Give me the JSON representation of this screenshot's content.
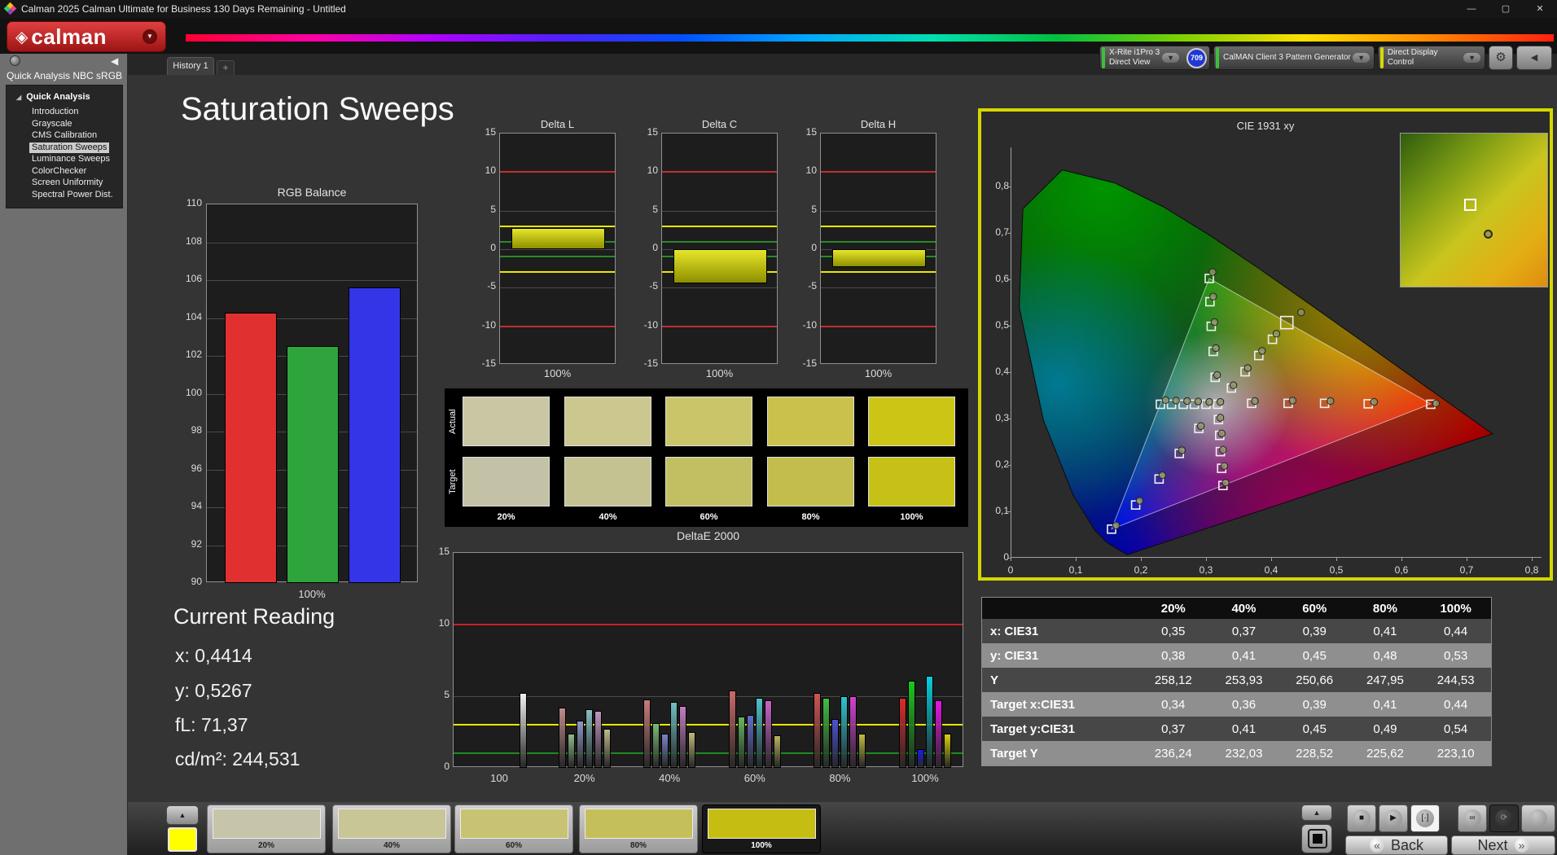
{
  "window": {
    "title": "Calman 2025 Calman Ultimate for Business 130 Days Remaining  - Untitled"
  },
  "icons": {
    "logo_diamond": "◈",
    "caret_down": "▼",
    "collapse_left": "◀",
    "tree_expander": "◢",
    "minimize": "—",
    "maximize": "▢",
    "close": "✕",
    "gear": "⚙",
    "plus": "+",
    "up_arrow": "▲",
    "stop": "■",
    "play": "▶",
    "pattern_window": "[·]",
    "infinity": "∞",
    "sync": "⟳",
    "back_chevron": "«",
    "next_chevron": "»"
  },
  "logo": {
    "text": "calman"
  },
  "tabs": [
    {
      "label": "History 1",
      "active": true
    },
    {
      "label": "+",
      "active": false
    }
  ],
  "meters": [
    {
      "line1": "X-Rite i1Pro 3",
      "line2": "Direct View",
      "accent": "#3dbf3d",
      "badge": "709"
    },
    {
      "line1": "CalMAN Client 3 Pattern Generator",
      "line2": "",
      "accent": "#3dbf3d",
      "badge": ""
    },
    {
      "line1": "Direct Display Control",
      "line2": "",
      "accent": "#d8d800",
      "badge": ""
    }
  ],
  "sidebar": {
    "title": "Quick Analysis NBC sRGB",
    "root": "Quick Analysis",
    "items": [
      "Introduction",
      "Grayscale",
      "CMS Calibration",
      "Saturation Sweeps",
      "Luminance Sweeps",
      "ColorChecker",
      "Screen Uniformity",
      "Spectral Power Dist."
    ],
    "selected_index": 3
  },
  "page": {
    "title": "Saturation Sweeps"
  },
  "current_reading": {
    "heading": "Current Reading",
    "lines": [
      "x: 0,4414",
      "y: 0,5267",
      "fL: 71,37",
      "cd/m²: 244,531"
    ]
  },
  "swatch_panel": {
    "row_labels": [
      "Actual",
      "Target"
    ],
    "column_labels": [
      "20%",
      "40%",
      "60%",
      "80%",
      "100%"
    ],
    "actual_colors": [
      "#c9c6a4",
      "#cbc78f",
      "#cbc56a",
      "#c9c14c",
      "#cdc516"
    ],
    "target_colors": [
      "#c3c2a6",
      "#c5c292",
      "#c2bf63",
      "#c3bd4e",
      "#c6c017"
    ]
  },
  "table": {
    "columns": [
      "20%",
      "40%",
      "60%",
      "80%",
      "100%"
    ],
    "rows": [
      {
        "label": "x: CIE31",
        "values": [
          "0,35",
          "0,37",
          "0,39",
          "0,41",
          "0,44"
        ]
      },
      {
        "label": "y: CIE31",
        "values": [
          "0,38",
          "0,41",
          "0,45",
          "0,48",
          "0,53"
        ]
      },
      {
        "label": "Y",
        "values": [
          "258,12",
          "253,93",
          "250,66",
          "247,95",
          "244,53"
        ]
      },
      {
        "label": "Target x:CIE31",
        "values": [
          "0,34",
          "0,36",
          "0,39",
          "0,41",
          "0,44"
        ]
      },
      {
        "label": "Target y:CIE31",
        "values": [
          "0,37",
          "0,41",
          "0,45",
          "0,49",
          "0,54"
        ]
      },
      {
        "label": "Target Y",
        "values": [
          "236,24",
          "232,03",
          "228,52",
          "225,62",
          "223,10"
        ]
      }
    ]
  },
  "bottom_bar": {
    "swatches": [
      {
        "label": "20%",
        "color": "#c6c5a9",
        "selected": false
      },
      {
        "label": "40%",
        "color": "#c8c597",
        "selected": false
      },
      {
        "label": "60%",
        "color": "#c7c372",
        "selected": false
      },
      {
        "label": "80%",
        "color": "#c5bf5b",
        "selected": false
      },
      {
        "label": "100%",
        "color": "#c6bd12",
        "selected": true
      }
    ],
    "back_label": "Back",
    "next_label": "Next"
  },
  "chart_data": [
    {
      "id": "rgb_balance",
      "type": "bar",
      "title": "RGB Balance",
      "categories": [
        "Red",
        "Green",
        "Blue"
      ],
      "values": [
        104.3,
        102.5,
        105.6
      ],
      "colors": [
        "#e03030",
        "#2fa43c",
        "#3535e8"
      ],
      "xlabel": "100%",
      "ylim": [
        90,
        110
      ],
      "yticks": [
        "110",
        "108",
        "106",
        "104",
        "102",
        "100",
        "98",
        "96",
        "94",
        "92",
        "90"
      ]
    },
    {
      "id": "delta_l",
      "type": "bar",
      "title": "Delta L",
      "categories": [
        "100%"
      ],
      "values": [
        2.7
      ],
      "xlabel": "100%",
      "ylim": [
        -15,
        15
      ],
      "yticks": [
        "15",
        "10",
        "5",
        "0",
        "-5",
        "-10",
        "-15"
      ],
      "ref_lines": [
        {
          "y": 10,
          "color": "#c03030"
        },
        {
          "y": -10,
          "color": "#c03030"
        },
        {
          "y": 3,
          "color": "#e8e800"
        },
        {
          "y": -3,
          "color": "#e8e800"
        },
        {
          "y": 1,
          "color": "#2a8a2a"
        },
        {
          "y": -1,
          "color": "#2a8a2a"
        }
      ]
    },
    {
      "id": "delta_c",
      "type": "bar",
      "title": "Delta C",
      "categories": [
        "100%"
      ],
      "values": [
        -4.4
      ],
      "xlabel": "100%",
      "ylim": [
        -15,
        15
      ],
      "yticks": [
        "15",
        "10",
        "5",
        "0",
        "-5",
        "-10",
        "-15"
      ],
      "ref_lines": [
        {
          "y": 10,
          "color": "#c03030"
        },
        {
          "y": -10,
          "color": "#c03030"
        },
        {
          "y": 3,
          "color": "#e8e800"
        },
        {
          "y": -3,
          "color": "#e8e800"
        },
        {
          "y": 1,
          "color": "#2a8a2a"
        },
        {
          "y": -1,
          "color": "#2a8a2a"
        }
      ]
    },
    {
      "id": "delta_h",
      "type": "bar",
      "title": "Delta H",
      "categories": [
        "100%"
      ],
      "values": [
        -2.3
      ],
      "xlabel": "100%",
      "ylim": [
        -15,
        15
      ],
      "yticks": [
        "15",
        "10",
        "5",
        "0",
        "-5",
        "-10",
        "-15"
      ],
      "ref_lines": [
        {
          "y": 10,
          "color": "#c03030"
        },
        {
          "y": -10,
          "color": "#c03030"
        },
        {
          "y": 3,
          "color": "#e8e800"
        },
        {
          "y": -3,
          "color": "#e8e800"
        },
        {
          "y": 1,
          "color": "#2a8a2a"
        },
        {
          "y": -1,
          "color": "#2a8a2a"
        }
      ]
    },
    {
      "id": "deltae2000",
      "type": "grouped-bar",
      "title": "DeltaE 2000",
      "categories": [
        "100",
        "20%",
        "40%",
        "60%",
        "80%",
        "100%"
      ],
      "groups": [
        [
          5.2
        ],
        [
          4.2,
          2.4,
          3.3,
          4.1,
          4.0,
          2.7
        ],
        [
          4.8,
          3.1,
          2.4,
          4.6,
          4.3,
          2.5
        ],
        [
          5.4,
          3.6,
          3.7,
          4.9,
          4.7,
          2.3
        ],
        [
          5.2,
          4.9,
          3.4,
          5.0,
          5.0,
          2.4
        ],
        [
          4.9,
          6.1,
          1.3,
          6.4,
          4.7,
          2.4
        ]
      ],
      "group_colors": [
        [
          "#f2f2f2"
        ],
        [
          "#c08a8a",
          "#8fba89",
          "#8f97c6",
          "#89bec2",
          "#c094c0",
          "#bfba8c"
        ],
        [
          "#c67d7d",
          "#7cba76",
          "#7b84c8",
          "#6fbec4",
          "#c47ec4",
          "#bfba77"
        ],
        [
          "#cb6a6a",
          "#64b65e",
          "#636cca",
          "#52c2c8",
          "#c963c9",
          "#b9b45d"
        ],
        [
          "#cf5454",
          "#3fbe3f",
          "#4a52d2",
          "#2ac6ce",
          "#d243d2",
          "#c2bb41"
        ],
        [
          "#d92c2c",
          "#1bc81b",
          "#1b1be4",
          "#06cede",
          "#e615e6",
          "#d8d012"
        ]
      ],
      "ylim": [
        0,
        15
      ],
      "yticks": [
        "0",
        "5",
        "10",
        "15"
      ],
      "ref_lines": [
        {
          "y": 10,
          "color": "#cc2020"
        },
        {
          "y": 3,
          "color": "#e8e800"
        },
        {
          "y": 1,
          "color": "#1e8a1e"
        }
      ]
    },
    {
      "id": "cie",
      "type": "scatter",
      "title": "CIE 1931 xy",
      "xlim": [
        0,
        0.8
      ],
      "ylim": [
        0,
        0.9
      ],
      "xticks": [
        "0",
        "0,1",
        "0,2",
        "0,3",
        "0,4",
        "0,5",
        "0,6",
        "0,7",
        "0,8"
      ],
      "yticks": [
        "0",
        "0,1",
        "0,2",
        "0,3",
        "0,4",
        "0,5",
        "0,6",
        "0,7",
        "0,8"
      ],
      "gamut_triangle": [
        [
          0.64,
          0.33
        ],
        [
          0.3,
          0.6
        ],
        [
          0.15,
          0.06
        ]
      ],
      "targets": [
        [
          0.313,
          0.329
        ],
        [
          0.365,
          0.331
        ],
        [
          0.421,
          0.331
        ],
        [
          0.477,
          0.331
        ],
        [
          0.544,
          0.33
        ],
        [
          0.64,
          0.329
        ],
        [
          0.309,
          0.387
        ],
        [
          0.306,
          0.443
        ],
        [
          0.303,
          0.497
        ],
        [
          0.301,
          0.55
        ],
        [
          0.3,
          0.6
        ],
        [
          0.284,
          0.277
        ],
        [
          0.254,
          0.223
        ],
        [
          0.223,
          0.168
        ],
        [
          0.187,
          0.112
        ],
        [
          0.15,
          0.06
        ],
        [
          0.295,
          0.329
        ],
        [
          0.277,
          0.329
        ],
        [
          0.26,
          0.329
        ],
        [
          0.242,
          0.329
        ],
        [
          0.225,
          0.329
        ],
        [
          0.314,
          0.296
        ],
        [
          0.316,
          0.262
        ],
        [
          0.317,
          0.227
        ],
        [
          0.319,
          0.191
        ],
        [
          0.321,
          0.154
        ],
        [
          0.334,
          0.364
        ],
        [
          0.355,
          0.399
        ],
        [
          0.376,
          0.434
        ],
        [
          0.397,
          0.469
        ],
        [
          0.419,
          0.505,
          1
        ]
      ],
      "measured": [
        [
          0.317,
          0.334
        ],
        [
          0.37,
          0.336
        ],
        [
          0.428,
          0.337
        ],
        [
          0.486,
          0.336
        ],
        [
          0.553,
          0.334
        ],
        [
          0.648,
          0.331
        ],
        [
          0.312,
          0.392
        ],
        [
          0.31,
          0.45
        ],
        [
          0.308,
          0.506
        ],
        [
          0.306,
          0.561
        ],
        [
          0.305,
          0.614
        ],
        [
          0.287,
          0.282
        ],
        [
          0.258,
          0.23
        ],
        [
          0.228,
          0.176
        ],
        [
          0.193,
          0.121
        ],
        [
          0.157,
          0.068
        ],
        [
          0.3,
          0.334
        ],
        [
          0.283,
          0.335
        ],
        [
          0.266,
          0.336
        ],
        [
          0.249,
          0.337
        ],
        [
          0.233,
          0.338
        ],
        [
          0.317,
          0.3
        ],
        [
          0.319,
          0.266
        ],
        [
          0.321,
          0.231
        ],
        [
          0.323,
          0.196
        ],
        [
          0.325,
          0.16
        ],
        [
          0.337,
          0.37
        ],
        [
          0.359,
          0.407
        ],
        [
          0.381,
          0.444
        ],
        [
          0.403,
          0.481
        ],
        [
          0.441,
          0.527
        ]
      ]
    }
  ]
}
